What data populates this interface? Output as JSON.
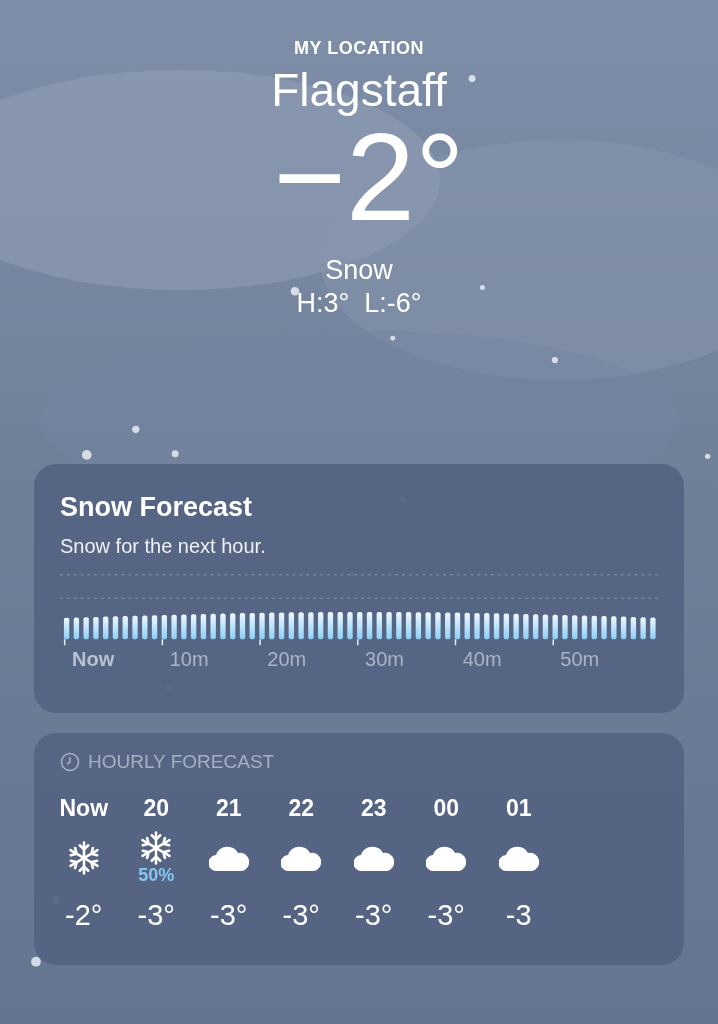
{
  "header": {
    "location_label": "MY LOCATION",
    "city": "Flagstaff",
    "temperature": "−2°",
    "condition": "Snow",
    "high_low": "H:3°  L:-6°"
  },
  "snow_forecast": {
    "title": "Snow Forecast",
    "summary": "Snow for the next hour.",
    "axis_labels": [
      {
        "label": "Now",
        "current": true
      },
      {
        "label": "10m",
        "current": false
      },
      {
        "label": "20m",
        "current": false
      },
      {
        "label": "30m",
        "current": false
      },
      {
        "label": "40m",
        "current": false
      },
      {
        "label": "50m",
        "current": false
      }
    ]
  },
  "hourly_forecast": {
    "title": "HOURLY FORECAST",
    "hours": [
      {
        "time": "Now",
        "kind": "snow",
        "temperature": "-2°"
      },
      {
        "time": "20",
        "kind": "snow",
        "chance": "50%",
        "temperature": "-3°"
      },
      {
        "time": "21",
        "kind": "cloud",
        "temperature": "-3°"
      },
      {
        "time": "22",
        "kind": "cloud",
        "temperature": "-3°"
      },
      {
        "time": "23",
        "kind": "cloud",
        "temperature": "-3°"
      },
      {
        "time": "00",
        "kind": "cloud",
        "temperature": "-3°"
      },
      {
        "time": "01",
        "kind": "cloud",
        "temperature": "-3"
      }
    ]
  }
}
